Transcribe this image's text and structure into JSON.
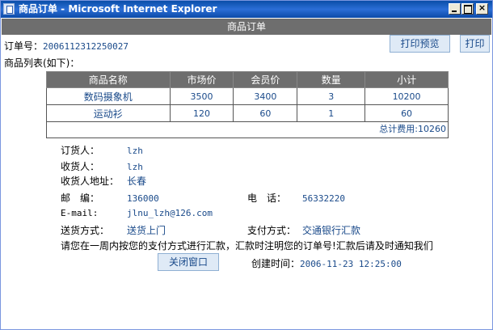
{
  "window": {
    "title": "商品订单 - Microsoft Internet Explorer",
    "controls": {
      "minimize": "_",
      "maximize": "□",
      "close": "×"
    }
  },
  "header": {
    "title": "商品订单"
  },
  "order": {
    "number_label": "订单号：",
    "number": "2006112312250027"
  },
  "toolbar": {
    "preview_label": "打印预览",
    "print_label": "打印"
  },
  "items": {
    "list_label": "商品列表(如下)：",
    "columns": [
      "商品名称",
      "市场价",
      "会员价",
      "数量",
      "小计"
    ],
    "rows": [
      [
        "数码摄象机",
        "3500",
        "3400",
        "3",
        "10200"
      ],
      [
        "运动衫",
        "120",
        "60",
        "1",
        "60"
      ]
    ],
    "total": "总计费用:10260"
  },
  "customer": {
    "orderer_label": "订货人：",
    "orderer": "lzh",
    "receiver_label": "收货人：",
    "receiver": "lzh",
    "address_label": "收货人地址：",
    "address": "长春",
    "zip_label": "邮　编：",
    "zip": "136000",
    "phone_label": "电　话：",
    "phone": "56332220",
    "email_label": "E-mail:",
    "email": "jlnu_lzh@126.com",
    "delivery_label": "送货方式：",
    "delivery": "送货上门",
    "payment_label": "支付方式：",
    "payment": "交通银行汇款"
  },
  "notice": "请您在一周内按您的支付方式进行汇款，汇款时注明您的订单号!汇款后请及时通知我们",
  "footer": {
    "close_label": "关闭窗口",
    "created_label": "创建时间：",
    "created": "2006-11-23 12:25:00"
  }
}
